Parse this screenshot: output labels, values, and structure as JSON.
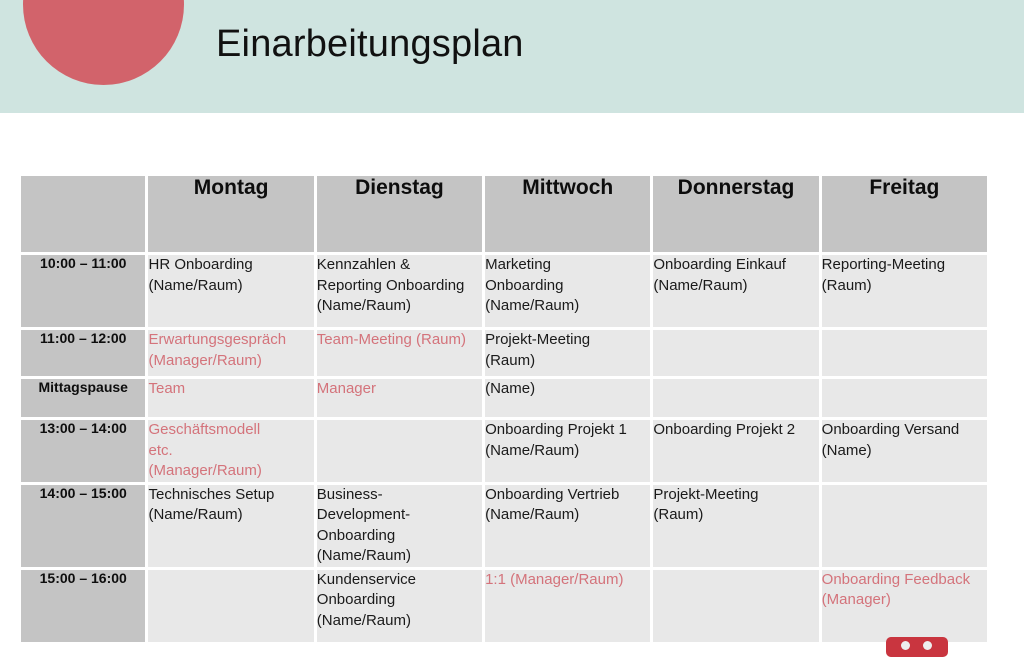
{
  "header": {
    "title": "Einarbeitungsplan",
    "band_color": "#cfe4e0",
    "circle_color": "#d2636b",
    "circle_icon": "decorative-circle"
  },
  "colors": {
    "header_cell_bg": "#c4c4c4",
    "slot_bg": "#e8e8e8",
    "text": "#1a1a1a",
    "accent_red": "#d4737b"
  },
  "table": {
    "corner_label": "",
    "columns": [
      {
        "key": "montag",
        "label": "Montag"
      },
      {
        "key": "dienstag",
        "label": "Dienstag"
      },
      {
        "key": "mittwoch",
        "label": "Mittwoch"
      },
      {
        "key": "donnerstag",
        "label": "Donnerstag"
      },
      {
        "key": "freitag",
        "label": "Freitag"
      }
    ],
    "rows": [
      {
        "time": "10:00 – 11:00",
        "cells": [
          {
            "lines": [
              "HR Onboarding",
              "(Name/Raum)"
            ],
            "red": false
          },
          {
            "lines": [
              "Kennzahlen &",
              "Reporting Onboarding",
              "(Name/Raum)"
            ],
            "red": false
          },
          {
            "lines": [
              "Marketing",
              "Onboarding",
              "(Name/Raum)"
            ],
            "red": false
          },
          {
            "lines": [
              "Onboarding Einkauf",
              "(Name/Raum)"
            ],
            "red": false
          },
          {
            "lines": [
              "Reporting-Meeting",
              "(Raum)"
            ],
            "red": false
          }
        ]
      },
      {
        "time": "11:00 – 12:00",
        "cells": [
          {
            "lines": [
              "Erwartungsgespräch",
              "(Manager/Raum)"
            ],
            "red": true
          },
          {
            "lines": [
              "Team-Meeting (Raum)"
            ],
            "red": true
          },
          {
            "lines": [
              "Projekt-Meeting",
              "(Raum)"
            ],
            "red": false
          },
          {
            "lines": [],
            "red": false
          },
          {
            "lines": [],
            "red": false
          }
        ]
      },
      {
        "time": "Mittagspause",
        "cells": [
          {
            "lines": [
              "Team"
            ],
            "red": true
          },
          {
            "lines": [
              "Manager"
            ],
            "red": true
          },
          {
            "lines": [
              "(Name)"
            ],
            "red": false
          },
          {
            "lines": [],
            "red": false
          },
          {
            "lines": [],
            "red": false
          }
        ]
      },
      {
        "time": "13:00 – 14:00",
        "cells": [
          {
            "lines": [
              "Geschäftsmodell",
              "etc.",
              "(Manager/Raum)"
            ],
            "red": true
          },
          {
            "lines": [],
            "red": false
          },
          {
            "lines": [
              "Onboarding Projekt 1",
              "(Name/Raum)"
            ],
            "red": false
          },
          {
            "lines": [
              "Onboarding Projekt 2"
            ],
            "red": false
          },
          {
            "lines": [
              "Onboarding Versand",
              "(Name)"
            ],
            "red": false
          }
        ]
      },
      {
        "time": "14:00 – 15:00",
        "cells": [
          {
            "lines": [
              "Technisches Setup",
              "(Name/Raum)"
            ],
            "red": false
          },
          {
            "lines": [
              "Business-",
              "Development-",
              "Onboarding",
              "(Name/Raum)"
            ],
            "red": false
          },
          {
            "lines": [
              "Onboarding Vertrieb",
              "(Name/Raum)"
            ],
            "red": false
          },
          {
            "lines": [
              "Projekt-Meeting",
              "(Raum)"
            ],
            "red": false
          },
          {
            "lines": [],
            "red": false
          }
        ]
      },
      {
        "time": "15:00 – 16:00",
        "cells": [
          {
            "lines": [],
            "red": false
          },
          {
            "lines": [
              "Kundenservice",
              "Onboarding",
              "(Name/Raum)"
            ],
            "red": false
          },
          {
            "lines": [
              "1:1 (Manager/Raum)"
            ],
            "red": true
          },
          {
            "lines": [],
            "red": false
          },
          {
            "lines": [
              "Onboarding Feedback",
              "(Manager)"
            ],
            "red": true
          }
        ]
      }
    ]
  },
  "decoration": {
    "bottom_right_icon": "clipped-red-badge"
  }
}
